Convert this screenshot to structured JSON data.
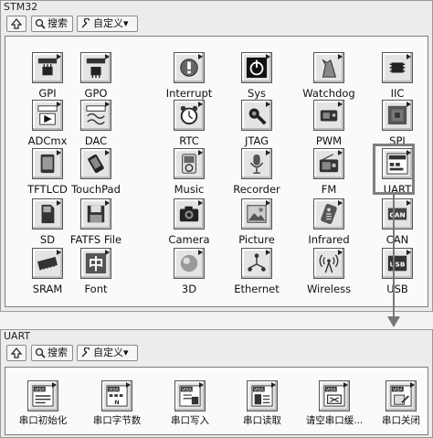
{
  "stm32": {
    "title": "STM32",
    "toolbar": {
      "search_label": "搜索",
      "custom_label": "自定义▾"
    },
    "items": [
      {
        "label": "GPI"
      },
      {
        "label": "GPO"
      },
      {
        "label": "Interrupt"
      },
      {
        "label": "Sys"
      },
      {
        "label": "Watchdog"
      },
      {
        "label": "IIC"
      },
      {
        "label": "ADCmx"
      },
      {
        "label": "DAC"
      },
      {
        "label": "RTC"
      },
      {
        "label": "JTAG"
      },
      {
        "label": "PWM"
      },
      {
        "label": "SPI"
      },
      {
        "label": "TFTLCD"
      },
      {
        "label": "TouchPad"
      },
      {
        "label": "Music"
      },
      {
        "label": "Recorder"
      },
      {
        "label": "FM"
      },
      {
        "label": "UART"
      },
      {
        "label": "SD"
      },
      {
        "label": "FATFS File"
      },
      {
        "label": "Camera"
      },
      {
        "label": "Picture"
      },
      {
        "label": "Infrared"
      },
      {
        "label": "CAN"
      },
      {
        "label": "SRAM"
      },
      {
        "label": "Font"
      },
      {
        "label": "3D"
      },
      {
        "label": "Ethernet"
      },
      {
        "label": "Wireless"
      },
      {
        "label": "USB"
      }
    ],
    "icon_text": {
      "stm32": "STM32",
      "serial": "SERIAL",
      "visa": "VISA",
      "can": "CAN",
      "usb": "USB",
      "font": "中"
    },
    "selected": "UART"
  },
  "uart": {
    "title": "UART",
    "toolbar": {
      "search_label": "搜索",
      "custom_label": "自定义▾"
    },
    "items": [
      {
        "label": "串口初始化"
      },
      {
        "label": "串口字节数"
      },
      {
        "label": "串口写入"
      },
      {
        "label": "串口读取"
      },
      {
        "label": "请空串口缓..."
      },
      {
        "label": "串口关闭"
      }
    ],
    "icon_text": {
      "visa": "VISA"
    }
  }
}
